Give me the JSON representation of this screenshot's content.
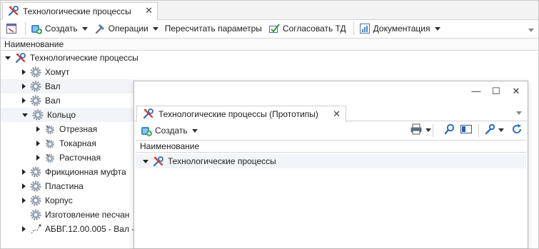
{
  "main": {
    "tab_title": "Технологические процессы",
    "toolbar": {
      "create": "Создать",
      "operations": "Операции",
      "recalc": "Пересчитать параметры",
      "approve": "Согласовать ТД",
      "docs": "Документация"
    },
    "column_header": "Наименование",
    "tree": {
      "root": "Технологические процессы",
      "items": [
        {
          "label": "Хомут"
        },
        {
          "label": "Вал"
        },
        {
          "label": "Вал"
        },
        {
          "label": "Кольцо"
        },
        {
          "label": "Отрезная"
        },
        {
          "label": "Токарная"
        },
        {
          "label": "Расточная"
        },
        {
          "label": "Фрикционная муфта"
        },
        {
          "label": "Пластина"
        },
        {
          "label": "Корпус"
        },
        {
          "label": "Изготовление песчан"
        },
        {
          "label": "АБВГ.12.00.005 - Вал  -"
        }
      ]
    }
  },
  "window": {
    "tab_title": "Технологические процессы (Прототипы)",
    "toolbar": {
      "create": "Создать"
    },
    "column_header": "Наименование",
    "tree_root": "Технологические процессы"
  }
}
